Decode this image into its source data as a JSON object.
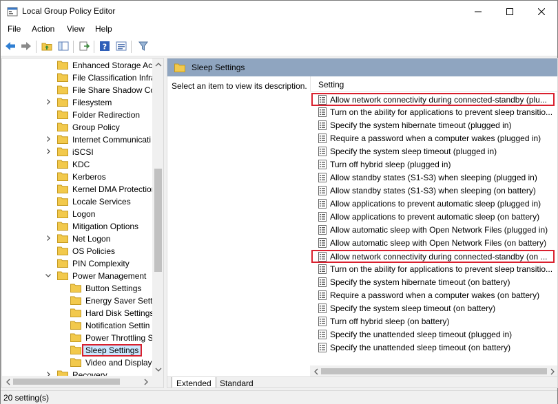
{
  "window": {
    "title": "Local Group Policy Editor"
  },
  "menu": [
    {
      "label": "File"
    },
    {
      "label": "Action"
    },
    {
      "label": "View"
    },
    {
      "label": "Help"
    }
  ],
  "tree": {
    "items": [
      {
        "label": "Enhanced Storage Acc",
        "level": 1,
        "expandable": false
      },
      {
        "label": "File Classification Infra",
        "level": 1,
        "expandable": false
      },
      {
        "label": "File Share Shadow Cop",
        "level": 1,
        "expandable": false
      },
      {
        "label": "Filesystem",
        "level": 1,
        "expandable": true
      },
      {
        "label": "Folder Redirection",
        "level": 1,
        "expandable": false
      },
      {
        "label": "Group Policy",
        "level": 1,
        "expandable": false
      },
      {
        "label": "Internet Communicati",
        "level": 1,
        "expandable": true
      },
      {
        "label": "iSCSI",
        "level": 1,
        "expandable": true
      },
      {
        "label": "KDC",
        "level": 1,
        "expandable": false
      },
      {
        "label": "Kerberos",
        "level": 1,
        "expandable": false
      },
      {
        "label": "Kernel DMA Protection",
        "level": 1,
        "expandable": false
      },
      {
        "label": "Locale Services",
        "level": 1,
        "expandable": false
      },
      {
        "label": "Logon",
        "level": 1,
        "expandable": false
      },
      {
        "label": "Mitigation Options",
        "level": 1,
        "expandable": false
      },
      {
        "label": "Net Logon",
        "level": 1,
        "expandable": true
      },
      {
        "label": "OS Policies",
        "level": 1,
        "expandable": false
      },
      {
        "label": "PIN Complexity",
        "level": 1,
        "expandable": false
      },
      {
        "label": "Power Management",
        "level": 1,
        "expandable": true,
        "expanded": true
      },
      {
        "label": "Button Settings",
        "level": 2,
        "expandable": false
      },
      {
        "label": "Energy Saver Settin",
        "level": 2,
        "expandable": false
      },
      {
        "label": "Hard Disk Settings",
        "level": 2,
        "expandable": false
      },
      {
        "label": "Notification Settin",
        "level": 2,
        "expandable": false
      },
      {
        "label": "Power Throttling S",
        "level": 2,
        "expandable": false
      },
      {
        "label": "Sleep Settings",
        "level": 2,
        "expandable": false,
        "selected": true
      },
      {
        "label": "Video and Display",
        "level": 2,
        "expandable": false
      },
      {
        "label": "Recovery",
        "level": 1,
        "expandable": true
      }
    ]
  },
  "right_pane": {
    "header": "Sleep Settings",
    "description": "Select an item to view its description.",
    "column_header": "Setting",
    "settings": [
      {
        "label": "Allow network connectivity during connected-standby (plu...",
        "highlight": true
      },
      {
        "label": "Turn on the ability for applications to prevent sleep transitio..."
      },
      {
        "label": "Specify the system hibernate timeout (plugged in)"
      },
      {
        "label": "Require a password when a computer wakes (plugged in)"
      },
      {
        "label": "Specify the system sleep timeout (plugged in)"
      },
      {
        "label": "Turn off hybrid sleep (plugged in)"
      },
      {
        "label": "Allow standby states (S1-S3) when sleeping (plugged in)"
      },
      {
        "label": "Allow standby states (S1-S3) when sleeping (on battery)"
      },
      {
        "label": "Allow applications to prevent automatic sleep (plugged in)"
      },
      {
        "label": "Allow applications to prevent automatic sleep (on battery)"
      },
      {
        "label": "Allow automatic sleep with Open Network Files (plugged in)"
      },
      {
        "label": "Allow automatic sleep with Open Network Files (on battery)"
      },
      {
        "label": "Allow network connectivity during connected-standby (on ...",
        "highlight": true
      },
      {
        "label": "Turn on the ability for applications to prevent sleep transitio..."
      },
      {
        "label": "Specify the system hibernate timeout (on battery)"
      },
      {
        "label": "Require a password when a computer wakes (on battery)"
      },
      {
        "label": "Specify the system sleep timeout (on battery)"
      },
      {
        "label": "Turn off hybrid sleep (on battery)"
      },
      {
        "label": "Specify the unattended sleep timeout (plugged in)"
      },
      {
        "label": "Specify the unattended sleep timeout (on battery)"
      }
    ],
    "tabs": [
      {
        "label": "Extended",
        "active": true
      },
      {
        "label": "Standard",
        "active": false
      }
    ]
  },
  "status": {
    "text": "20 setting(s)"
  },
  "colors": {
    "header_band": "#8fa5c0",
    "highlight_border": "#d9202e",
    "selection": "#cce8ff",
    "folder": "#f2c94c"
  }
}
